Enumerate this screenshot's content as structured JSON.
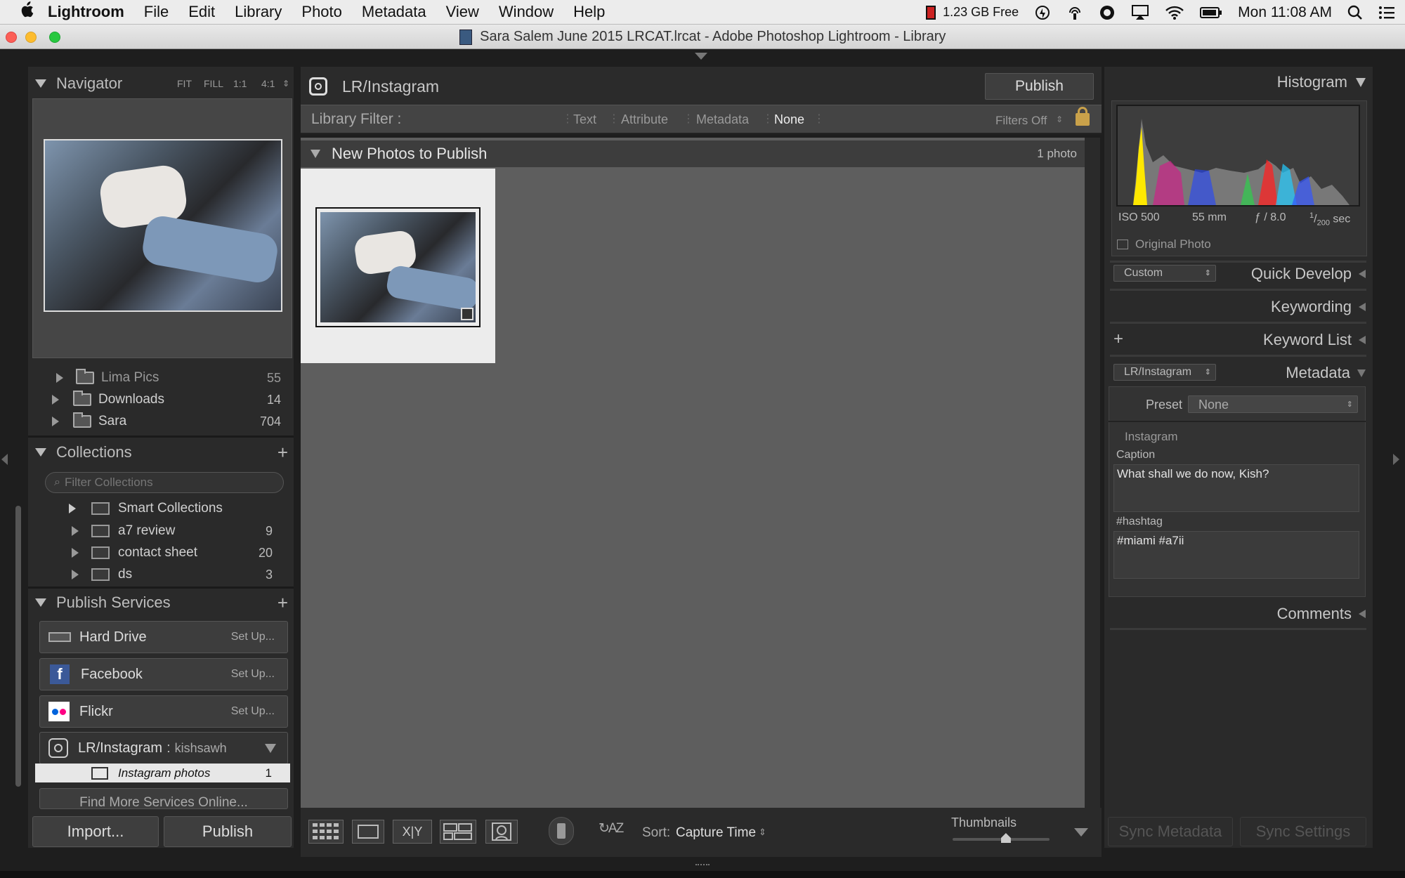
{
  "menubar": {
    "apple": "",
    "app_name": "Lightroom",
    "items": [
      "File",
      "Edit",
      "Library",
      "Photo",
      "Metadata",
      "View",
      "Window",
      "Help"
    ],
    "status": {
      "memory": "1.23 GB Free",
      "clock": "Mon 11:08 AM"
    }
  },
  "window": {
    "title": "Sara Salem June 2015 LRCAT.lrcat - Adobe Photoshop Lightroom - Library"
  },
  "navigator": {
    "title": "Navigator",
    "zoom_options": [
      "FIT",
      "FILL",
      "1:1",
      "4:1"
    ]
  },
  "folders": [
    {
      "name": "Lima Pics",
      "count": "55"
    },
    {
      "name": "Downloads",
      "count": "14"
    },
    {
      "name": "Sara",
      "count": "704"
    }
  ],
  "collections": {
    "title": "Collections",
    "add": "+",
    "filter_placeholder": "Filter Collections",
    "items": [
      {
        "name": "Smart Collections",
        "count": ""
      },
      {
        "name": "a7 review",
        "count": "9"
      },
      {
        "name": "contact sheet",
        "count": "20"
      },
      {
        "name": "ds",
        "count": "3"
      }
    ]
  },
  "publish_services": {
    "title": "Publish Services",
    "add": "+",
    "services": [
      {
        "name": "Hard Drive",
        "action": "Set Up..."
      },
      {
        "name": "Facebook",
        "action": "Set Up..."
      },
      {
        "name": "Flickr",
        "action": "Set Up..."
      }
    ],
    "instagram": {
      "name": "LR/Instagram",
      "separator": ":",
      "account": "kishsawh"
    },
    "sub": {
      "name": "Instagram photos",
      "count": "1"
    },
    "find_more": "Find More Services Online..."
  },
  "left_buttons": {
    "import": "Import...",
    "publish": "Publish"
  },
  "center": {
    "service_title": "LR/Instagram",
    "publish_button": "Publish",
    "filter": {
      "label": "Library Filter :",
      "options": [
        "Text",
        "Attribute",
        "Metadata",
        "None"
      ],
      "filters_off": "Filters Off"
    },
    "section": {
      "title": "New Photos to Publish",
      "count": "1 photo"
    }
  },
  "toolbar": {
    "sort_label": "Sort:",
    "sort_value": "Capture Time",
    "thumbnails_label": "Thumbnails",
    "thumbnail_size": 0.55
  },
  "histogram": {
    "title": "Histogram",
    "iso": "ISO 500",
    "focal": "55 mm",
    "aperture": "ƒ / 8.0",
    "shutter_num": "1",
    "shutter_den": "200",
    "shutter_unit": "sec",
    "original_photo": "Original Photo"
  },
  "right_panels": {
    "quick_develop_preset": "Custom",
    "quick_develop": "Quick Develop",
    "keywording": "Keywording",
    "keyword_list_add": "+",
    "keyword_list": "Keyword List",
    "metadata_set": "LR/Instagram",
    "metadata": "Metadata",
    "preset_label": "Preset",
    "preset_value": "None",
    "instagram_label": "Instagram",
    "caption_label": "Caption",
    "caption_value": "What shall we do now, Kish?",
    "hashtag_label": "#hashtag",
    "hashtag_value": "#miami #a7ii",
    "comments": "Comments"
  },
  "right_buttons": {
    "sync_metadata": "Sync Metadata",
    "sync_settings": "Sync Settings"
  },
  "colors": {
    "panel": "#2b2b2b",
    "grid": "#5e5e5e",
    "accent_selected": "#e8e8e8"
  }
}
